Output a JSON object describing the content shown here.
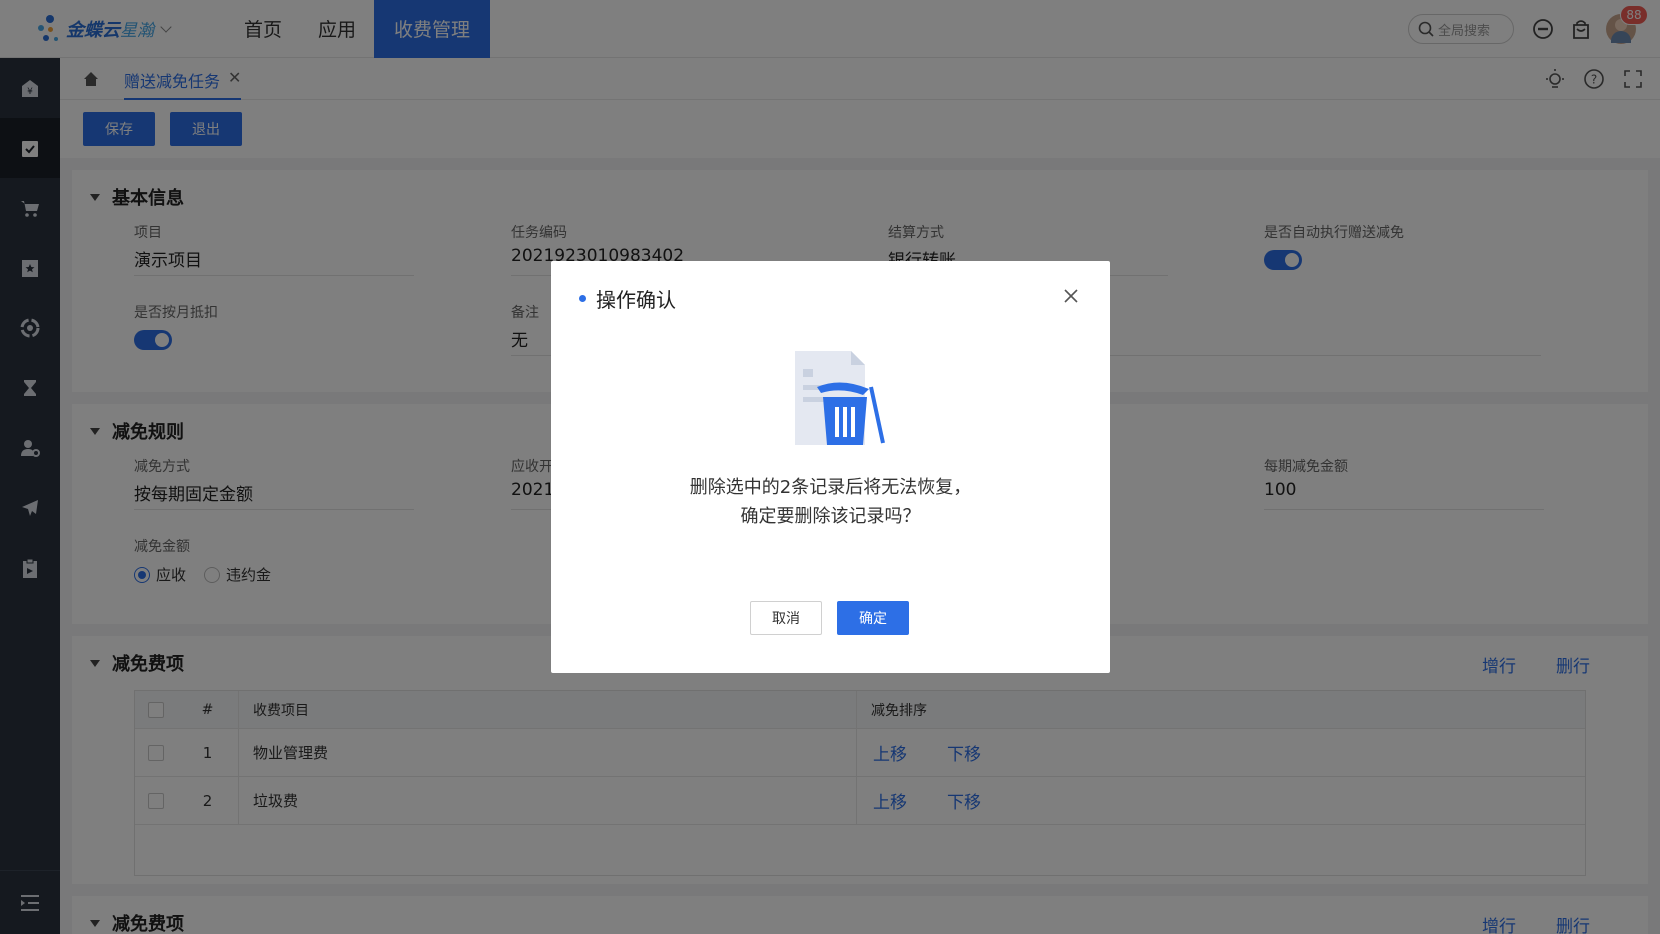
{
  "app": {
    "logo_text": "金蝶云",
    "logo_text2": "星瀚",
    "nav": [
      "首页",
      "应用",
      "收费管理"
    ],
    "search_placeholder": "全局搜索",
    "notification_count": "88"
  },
  "tabbar": {
    "tab_label": "赠送减免任务",
    "close_glyph": "✕"
  },
  "toolbar": {
    "save_label": "保存",
    "exit_label": "退出"
  },
  "basic_info": {
    "title": "基本信息",
    "project_label": "项目",
    "project_value": "演示项目",
    "task_code_label": "任务编码",
    "task_code_value": "2021923010983402",
    "settle_label": "结算方式",
    "settle_value": "银行转账",
    "auto_exec_label": "是否自动执行赠送减免",
    "monthly_label": "是否按月抵扣",
    "remark_label": "备注",
    "remark_value": "无"
  },
  "rules": {
    "title": "减免规则",
    "method_label": "减免方式",
    "method_value": "按每期固定金额",
    "receivable_label": "应收开",
    "receivable_value": "2021",
    "per_period_label": "每期减免金额",
    "per_period_value": "100",
    "amount_label": "减免金额",
    "radio_options": [
      "应收",
      "违约金"
    ]
  },
  "fee_items": {
    "title": "减免费项",
    "add_row": "增行",
    "delete_row": "删行",
    "columns": [
      "#",
      "收费项目",
      "减免排序"
    ],
    "rows": [
      {
        "no": "1",
        "item": "物业管理费",
        "up": "上移",
        "down": "下移"
      },
      {
        "no": "2",
        "item": "垃圾费",
        "up": "上移",
        "down": "下移"
      }
    ]
  },
  "fee_items2": {
    "title": "减免费项",
    "add_row": "增行",
    "delete_row": "删行"
  },
  "modal": {
    "title": "操作确认",
    "message_line1": "删除选中的2条记录后将无法恢复，",
    "message_line2": "确定要删除该记录吗？",
    "cancel_label": "取消",
    "ok_label": "确定"
  }
}
